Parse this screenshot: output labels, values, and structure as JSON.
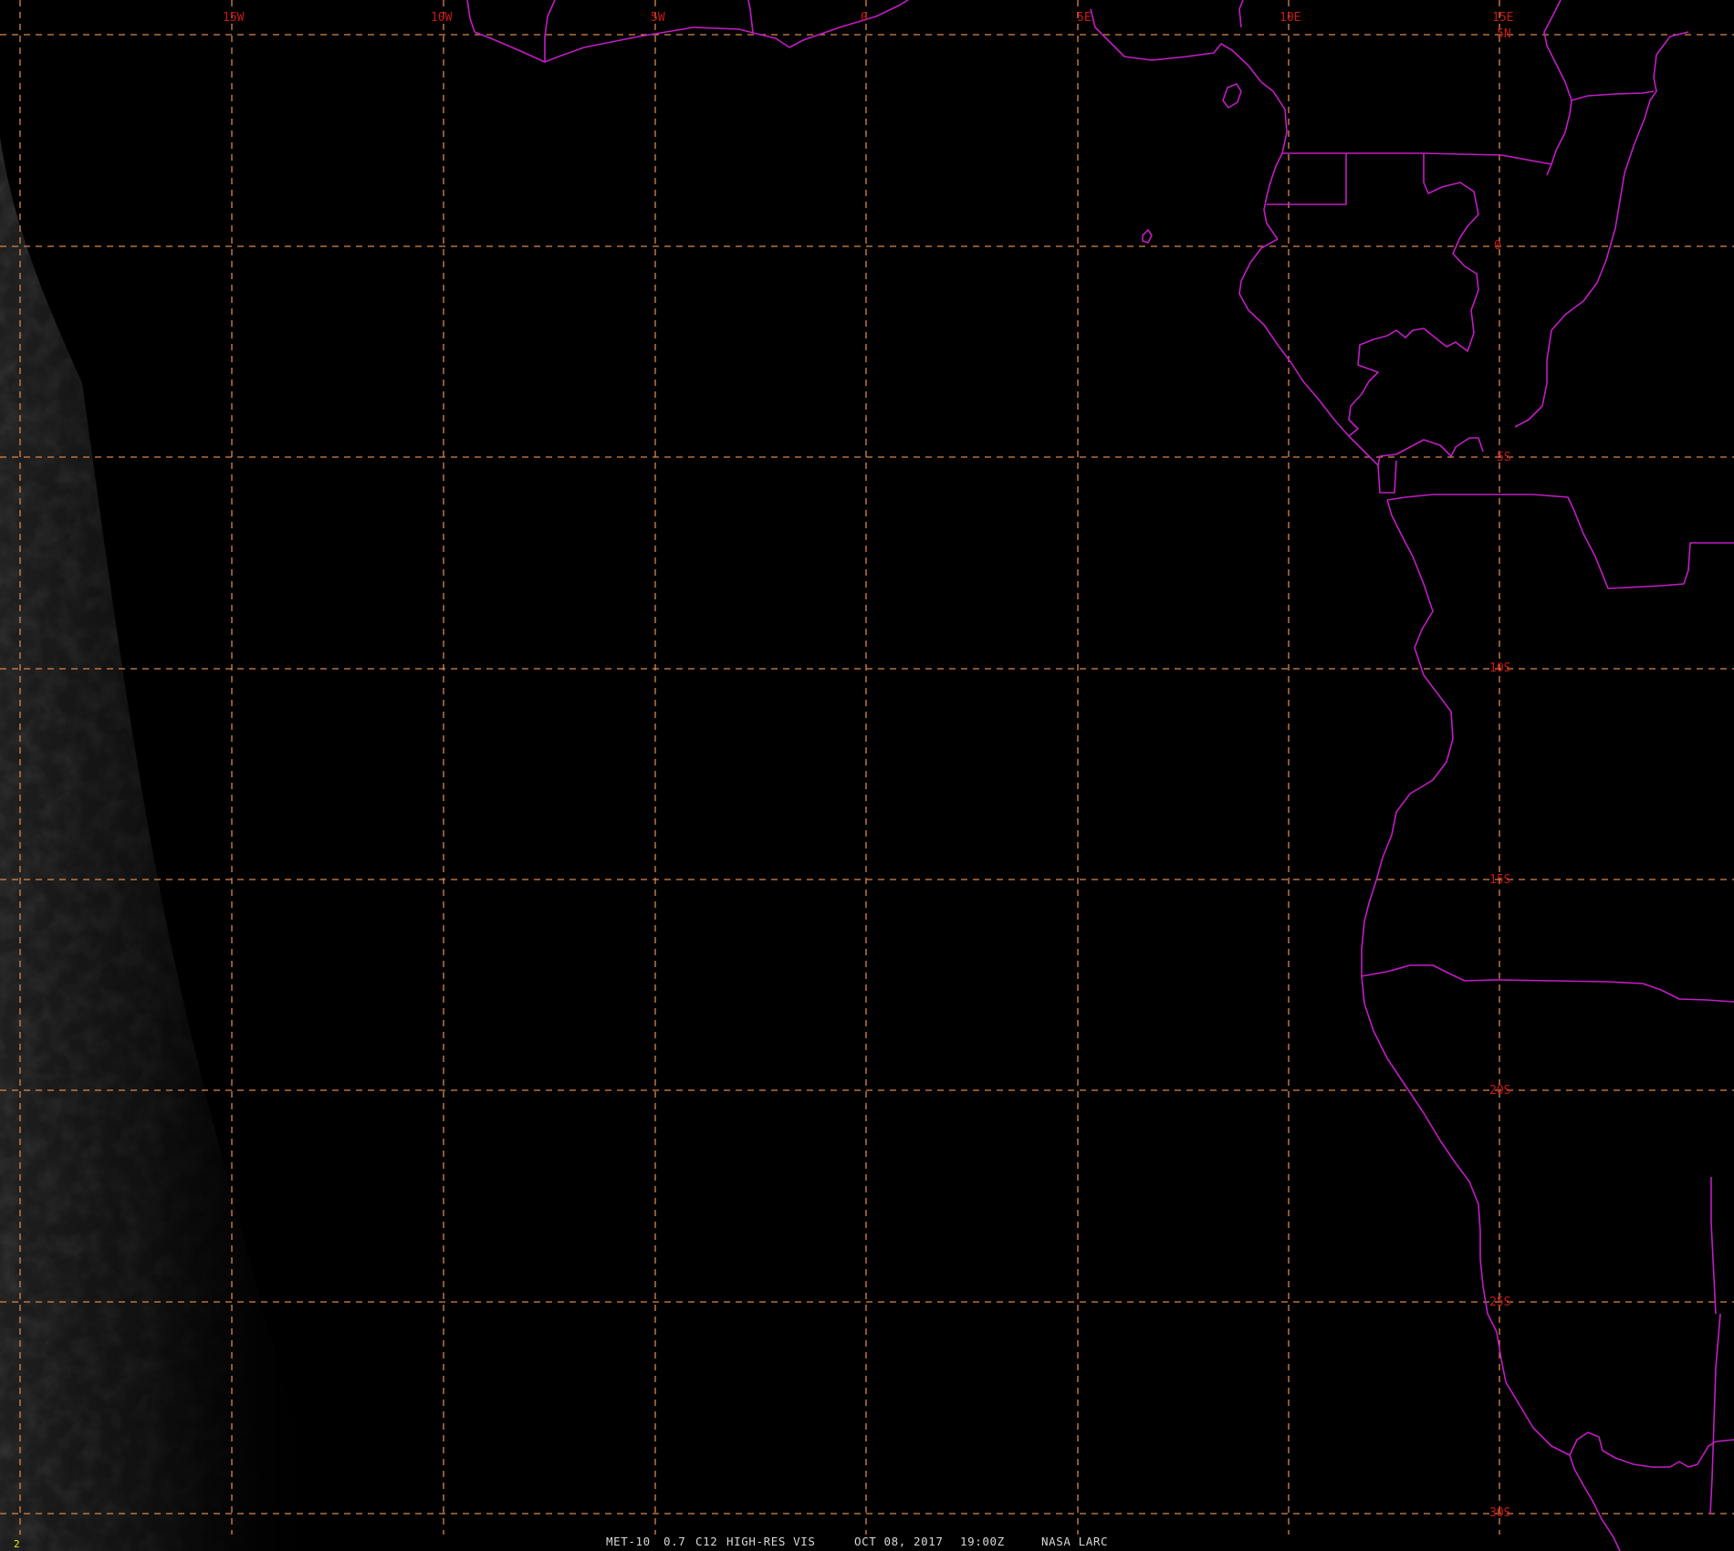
{
  "product": {
    "satellite": "MET-10",
    "band": "0.7",
    "channel": "C12",
    "type": "HIGH-RES VIS",
    "date": "OCT 08, 2017",
    "time": "19:00Z",
    "source": "NASA LARC"
  },
  "frame_number": "2",
  "longitude_labels": [
    "15W",
    "10W",
    "5W",
    "0",
    "5E",
    "10E",
    "15E"
  ],
  "latitude_labels": [
    "5N",
    "0",
    "5S",
    "10S",
    "15S",
    "20S",
    "25S",
    "30S"
  ],
  "colors": {
    "background": "#000000",
    "graticule": "#d9874a",
    "borders": "#c21cc4",
    "grid_labels": "#c81818",
    "footer_text": "#d8d8d8",
    "frame_number": "#e8e800"
  },
  "map": {
    "projection": "satellite geostationary view",
    "region": "Gulf of Guinea / South Atlantic, western coast of central and southern Africa",
    "overlays": [
      "lat-lon graticule",
      "coastlines and political boundaries"
    ],
    "illumination": "night side; faint twilight cloud texture at the western edge"
  }
}
